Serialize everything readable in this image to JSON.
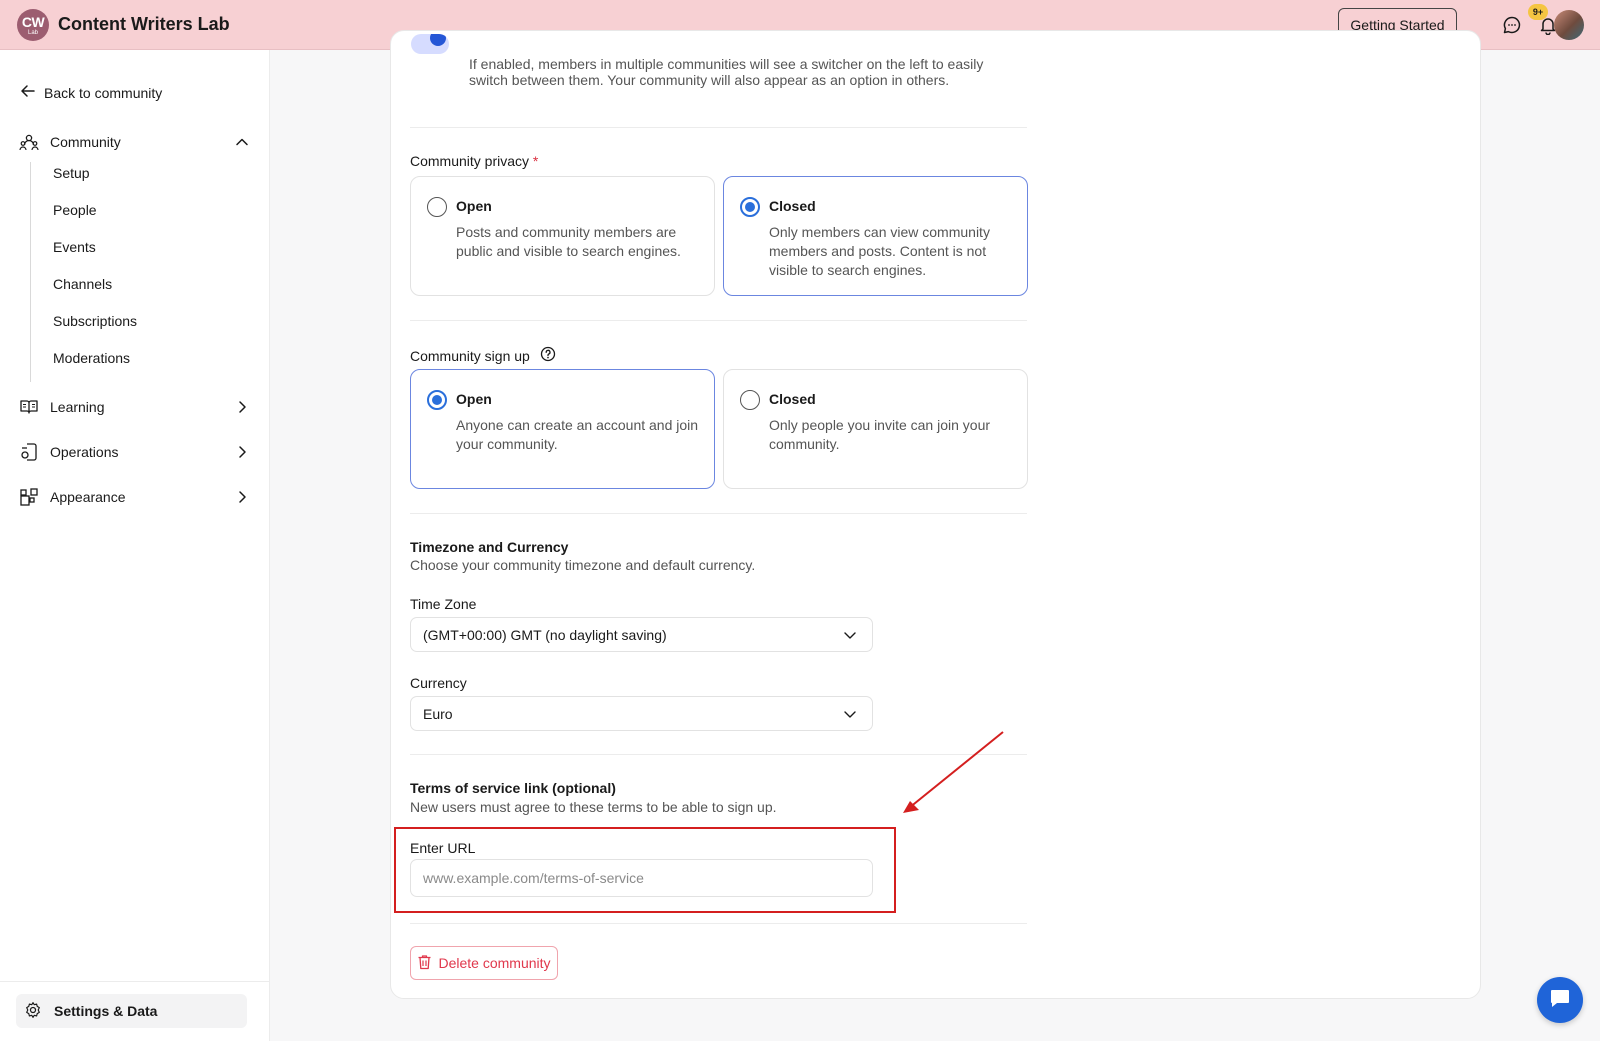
{
  "header": {
    "logo_line1": "CW",
    "logo_line2": "Lab",
    "app_title": "Content Writers Lab",
    "getting_started_label": "Getting Started",
    "notification_count": "9+"
  },
  "sidebar": {
    "back_label": "Back to community",
    "groups": {
      "community": "Community",
      "learning": "Learning",
      "operations": "Operations",
      "appearance": "Appearance"
    },
    "community_items": [
      "Setup",
      "People",
      "Events",
      "Channels",
      "Subscriptions",
      "Moderations"
    ],
    "settings_label": "Settings & Data"
  },
  "main": {
    "switcher_help": "If enabled, members in multiple communities will see a switcher on the left to easily switch between them. Your community will also appear as an option in others.",
    "privacy": {
      "label": "Community privacy",
      "required_mark": "*",
      "options": [
        {
          "title": "Open",
          "desc": "Posts and community members are public and visible to search engines.",
          "selected": false
        },
        {
          "title": "Closed",
          "desc": "Only members can view community members and posts. Content is not visible to search engines.",
          "selected": true
        }
      ]
    },
    "signup": {
      "label": "Community sign up",
      "options": [
        {
          "title": "Open",
          "desc": "Anyone can create an account and join your community.",
          "selected": true
        },
        {
          "title": "Closed",
          "desc": "Only people you invite can join your community.",
          "selected": false
        }
      ]
    },
    "timezone_currency": {
      "title": "Timezone and Currency",
      "desc": "Choose your community timezone and default currency.",
      "timezone_label": "Time Zone",
      "timezone_value": "(GMT+00:00) GMT (no daylight saving)",
      "currency_label": "Currency",
      "currency_value": "Euro"
    },
    "terms": {
      "title": "Terms of service link (optional)",
      "desc": "New users must agree to these terms to be able to sign up.",
      "url_label": "Enter URL",
      "url_placeholder": "www.example.com/terms-of-service",
      "url_value": ""
    },
    "delete_label": "Delete community"
  },
  "colors": {
    "header_bg": "#f7d0d3",
    "accent": "#2a6fdb",
    "danger": "#e0384c",
    "annotation": "#d41f1f"
  }
}
